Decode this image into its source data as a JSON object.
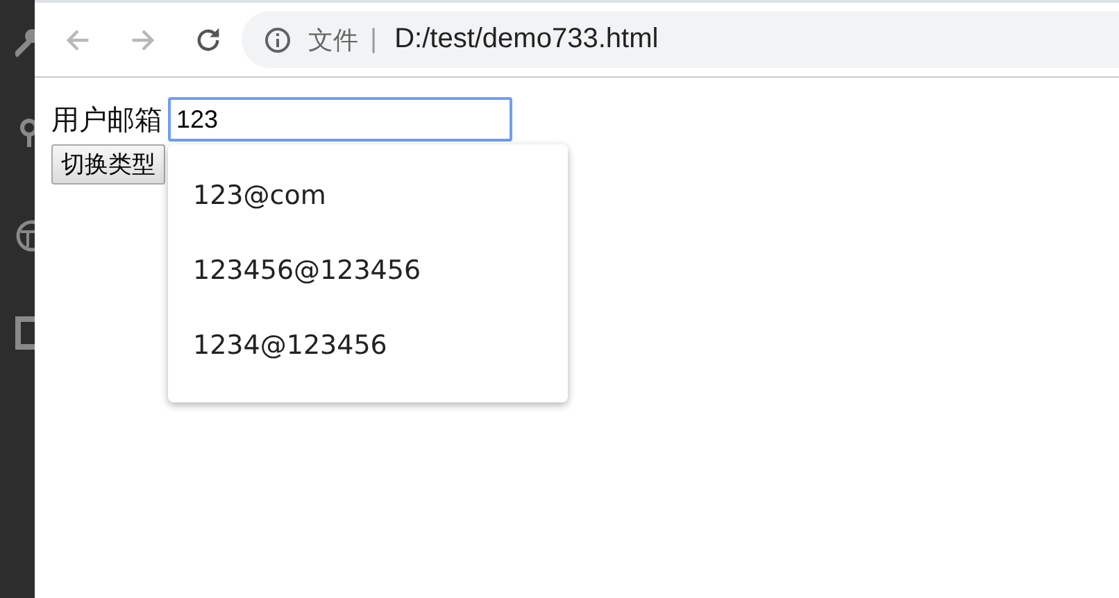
{
  "toolbar": {
    "security_label": "文件",
    "separator": "|",
    "url": "D:/test/demo733.html"
  },
  "form": {
    "label": "用户邮箱",
    "email_field": {
      "value": "123"
    },
    "button": "切换类型"
  },
  "suggestions": [
    {
      "text": "123@com"
    },
    {
      "text": "123456@123456"
    },
    {
      "text": "1234@123456"
    }
  ]
}
